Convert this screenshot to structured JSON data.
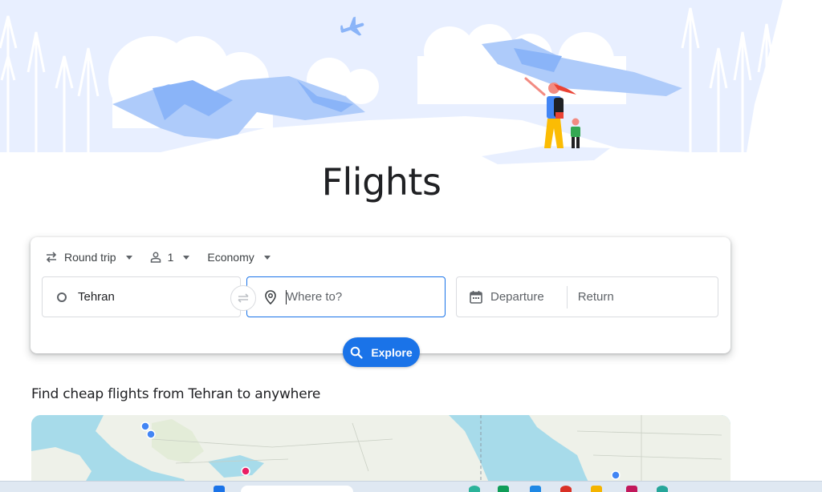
{
  "page": {
    "title": "Flights"
  },
  "trip_options": {
    "trip_type": "Round trip",
    "passengers": "1",
    "cabin_class": "Economy"
  },
  "search": {
    "origin_value": "Tehran",
    "destination_placeholder": "Where to?",
    "departure_placeholder": "Departure",
    "return_placeholder": "Return",
    "explore_label": "Explore"
  },
  "cheap_flights": {
    "heading": "Find cheap flights from Tehran to anywhere"
  },
  "colors": {
    "accent": "#1a73e8",
    "sky": "#e8efff",
    "mountain": "#aecbfa",
    "map_water": "#a7dbea",
    "map_land": "#f1f3ef",
    "marker_pink": "#e91e63"
  },
  "icons": {
    "trip": "swap-arrows-icon",
    "passenger": "person-icon",
    "origin": "circle-icon",
    "destination": "location-pin-icon",
    "swap": "swap-icon",
    "calendar": "calendar-icon",
    "explore": "search-icon"
  }
}
